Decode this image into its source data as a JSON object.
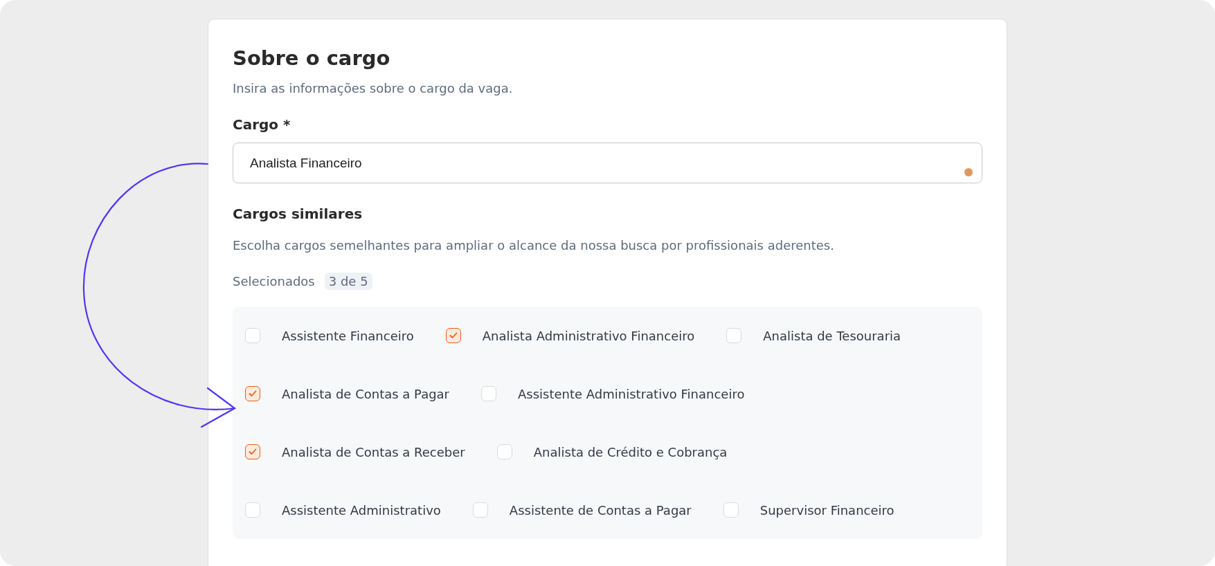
{
  "section": {
    "title": "Sobre o cargo",
    "subtitle": "Insira as informações sobre o cargo da vaga."
  },
  "cargo": {
    "label": "Cargo *",
    "value": "Analista Financeiro"
  },
  "similar": {
    "title": "Cargos similares",
    "description": "Escolha cargos semelhantes para ampliar o alcance da nossa busca por profissionais aderentes.",
    "selected_label": "Selecionados",
    "selected_count": "3 de 5",
    "rows": [
      {
        "options": [
          {
            "label": "Assistente Financeiro",
            "checked": false
          },
          {
            "label": "Analista Administrativo Financeiro",
            "checked": true
          },
          {
            "label": "Analista de Tesouraria",
            "checked": false
          }
        ]
      },
      {
        "options": [
          {
            "label": "Analista de Contas a Pagar",
            "checked": true
          },
          {
            "label": "Assistente Administrativo Financeiro",
            "checked": false
          }
        ]
      },
      {
        "options": [
          {
            "label": "Analista de Contas a Receber",
            "checked": true
          },
          {
            "label": "Analista de Crédito e Cobrança",
            "checked": false
          }
        ]
      },
      {
        "options": [
          {
            "label": "Assistente Administrativo",
            "checked": false
          },
          {
            "label": "Assistente de Contas a Pagar",
            "checked": false
          },
          {
            "label": "Supervisor Financeiro",
            "checked": false
          }
        ]
      }
    ]
  }
}
